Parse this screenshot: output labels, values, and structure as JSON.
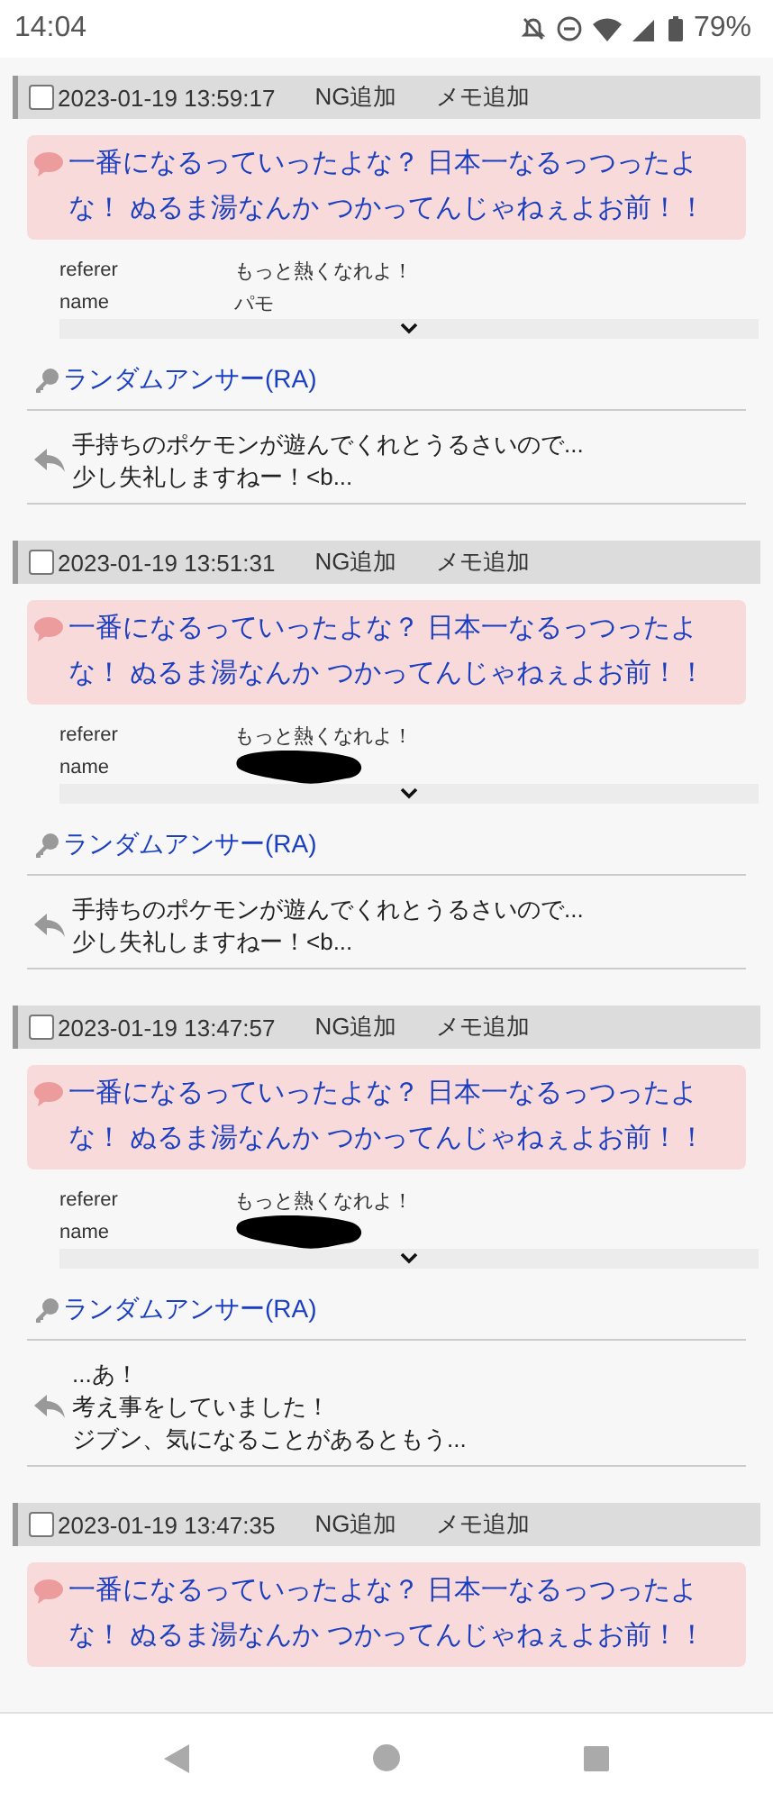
{
  "status_bar": {
    "time": "14:04",
    "battery": "79%"
  },
  "posts": [
    {
      "checked": false,
      "date": "2023-01-19 13:59:17",
      "actions": [
        "NG追加",
        "メモ追加"
      ],
      "message": "一番になるっていったよな？ 日本一なるっつったよな！ ぬるま湯なんか つかってんじゃねぇよお前！！",
      "details": [
        {
          "label": "referer",
          "value": "もっと熱くなれよ！",
          "redacted": false
        },
        {
          "label": "name",
          "value": "パモ",
          "redacted": false
        }
      ],
      "author": "ランダムアンサー(RA)",
      "reply_lines": [
        "手持ちのポケモンが遊んでくれとうるさいので...",
        "少し失礼しますねー！<b..."
      ]
    },
    {
      "checked": false,
      "date": "2023-01-19 13:51:31",
      "actions": [
        "NG追加",
        "メモ追加"
      ],
      "message": "一番になるっていったよな？ 日本一なるっつったよな！ ぬるま湯なんか つかってんじゃねぇよお前！！",
      "details": [
        {
          "label": "referer",
          "value": "もっと熱くなれよ！",
          "redacted": false
        },
        {
          "label": "name",
          "redacted": true
        }
      ],
      "author": "ランダムアンサー(RA)",
      "reply_lines": [
        "手持ちのポケモンが遊んでくれとうるさいので...",
        "少し失礼しますねー！<b..."
      ]
    },
    {
      "checked": false,
      "date": "2023-01-19 13:47:57",
      "actions": [
        "NG追加",
        "メモ追加"
      ],
      "message": "一番になるっていったよな？ 日本一なるっつったよな！ ぬるま湯なんか つかってんじゃねぇよお前！！",
      "details": [
        {
          "label": "referer",
          "value": "もっと熱くなれよ！",
          "redacted": false
        },
        {
          "label": "name",
          "redacted": true
        }
      ],
      "author": "ランダムアンサー(RA)",
      "reply_lines": [
        "...あ！",
        "考え事をしていました！",
        "ジブン、気になることがあるともう..."
      ]
    },
    {
      "checked": false,
      "date": "2023-01-19 13:47:35",
      "actions": [
        "NG追加",
        "メモ追加"
      ],
      "message": "一番になるっていったよな？ 日本一なるっつったよな！ ぬるま湯なんか つかってんじゃねぇよお前！！"
    }
  ]
}
